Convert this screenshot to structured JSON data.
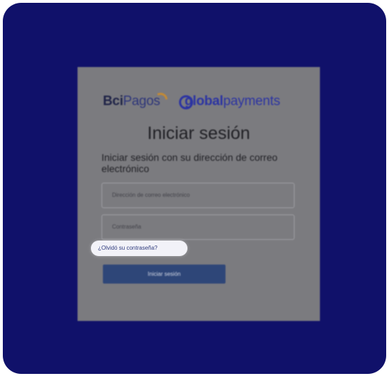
{
  "brand": {
    "bci": "Bci",
    "pagos": "Pagos",
    "gp_global": "global",
    "gp_payments": "payments"
  },
  "login": {
    "title": "Iniciar sesión",
    "subtitle": "Iniciar sesión con su dirección de correo electrónico",
    "email_placeholder": "Dirección de correo electrónico",
    "password_placeholder": "Contraseña",
    "forgot_link": "¿Olvidó su contraseña?",
    "submit_label": "Iniciar sesión"
  },
  "colors": {
    "backdrop": "#10116a",
    "card": "#7b7b7f",
    "button": "#2e4678",
    "highlight": "#f2f2f8",
    "globalpayments": "#2b33a2",
    "bci_accent": "#c38a35"
  }
}
